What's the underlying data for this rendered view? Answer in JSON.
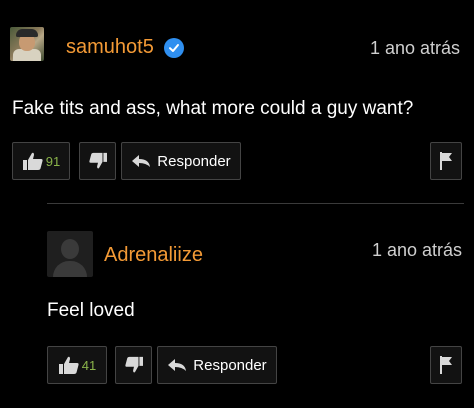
{
  "comments": [
    {
      "username": "samuhot5",
      "verified": true,
      "time": "1 ano atrás",
      "text": "Fake tits and ass, what more could a guy want?",
      "likes": "91",
      "reply_label": "Responder"
    },
    {
      "username": "Adrenaliize",
      "verified": false,
      "time": "1 ano atrás",
      "text": "Feel loved",
      "likes": "41",
      "reply_label": "Responder"
    }
  ],
  "colors": {
    "username": "#f39a36",
    "like_count": "#8ab34a",
    "verified_badge": "#2f8ff0",
    "background": "#000000"
  },
  "icons": [
    "thumbs-up-icon",
    "thumbs-down-icon",
    "reply-arrow-icon",
    "flag-icon",
    "verified-check-icon"
  ]
}
